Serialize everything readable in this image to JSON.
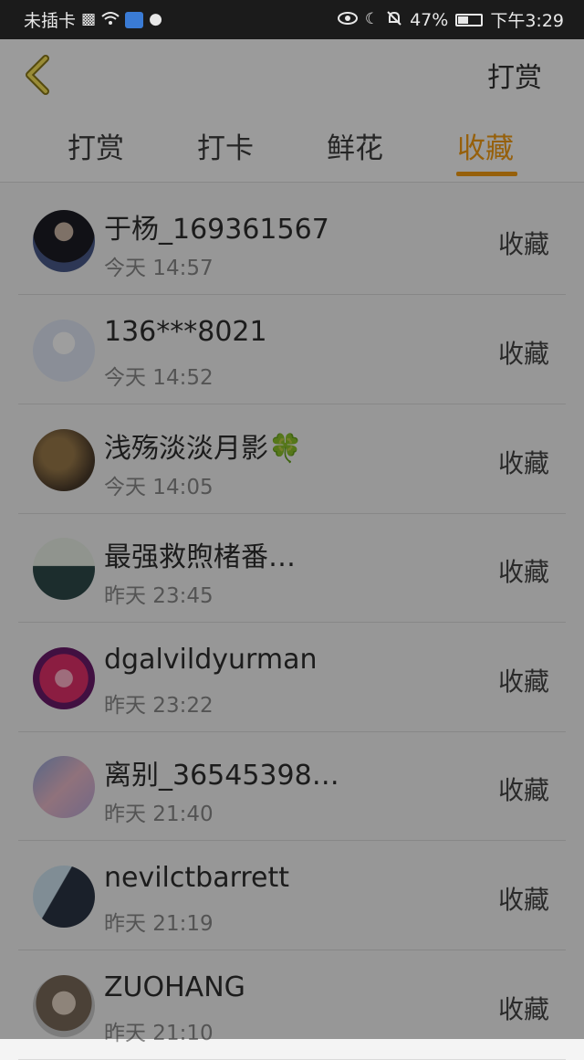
{
  "status_bar": {
    "carrier": "未插卡",
    "battery_percent": "47%",
    "battery_level": 0.47,
    "time": "下午3:29"
  },
  "header": {
    "back_icon": "chevron-left-icon",
    "action_label": "打赏"
  },
  "tabs": [
    {
      "label": "打赏",
      "active": false
    },
    {
      "label": "打卡",
      "active": false
    },
    {
      "label": "鲜花",
      "active": false
    },
    {
      "label": "收藏",
      "active": true
    }
  ],
  "colors": {
    "accent": "#f39c12"
  },
  "items": [
    {
      "name": "于杨_169361567",
      "time": "今天 14:57",
      "action": "收藏"
    },
    {
      "name": "136***8021",
      "time": "今天 14:52",
      "action": "收藏"
    },
    {
      "name": "浅殇淡淡月影🍀",
      "time": "今天 14:05",
      "action": "收藏"
    },
    {
      "name": "最强救煦楮番…",
      "time": "昨天 23:45",
      "action": "收藏"
    },
    {
      "name": "dgalvildyurman",
      "time": "昨天 23:22",
      "action": "收藏"
    },
    {
      "name": "离别_36545398…",
      "time": "昨天 21:40",
      "action": "收藏"
    },
    {
      "name": "nevilctbarrett",
      "time": "昨天 21:19",
      "action": "收藏"
    },
    {
      "name": "ZUOHANG",
      "time": "昨天 21:10",
      "action": "收藏"
    }
  ]
}
